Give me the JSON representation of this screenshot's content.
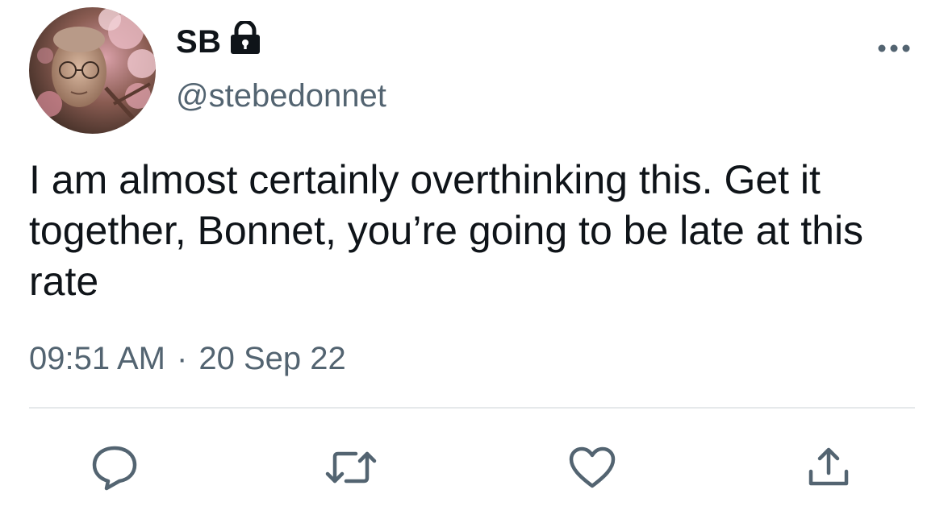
{
  "author": {
    "display_name": "SB",
    "handle": "@stebedonnet",
    "protected": true,
    "avatar_icon": "avatar-photo-with-pink-blossoms"
  },
  "tweet": {
    "text": "I am almost certainly overthinking this. Get it together, Bonnet, you’re going to be late at this rate",
    "time": "09:51 AM",
    "separator": "·",
    "date": "20 Sep 22"
  },
  "actions": {
    "reply_icon": "reply-icon",
    "retweet_icon": "retweet-icon",
    "like_icon": "heart-icon",
    "share_icon": "share-icon",
    "more_icon": "more-icon"
  },
  "colors": {
    "text": "#0f1419",
    "secondary": "#536471",
    "divider": "#e6e9eb"
  }
}
